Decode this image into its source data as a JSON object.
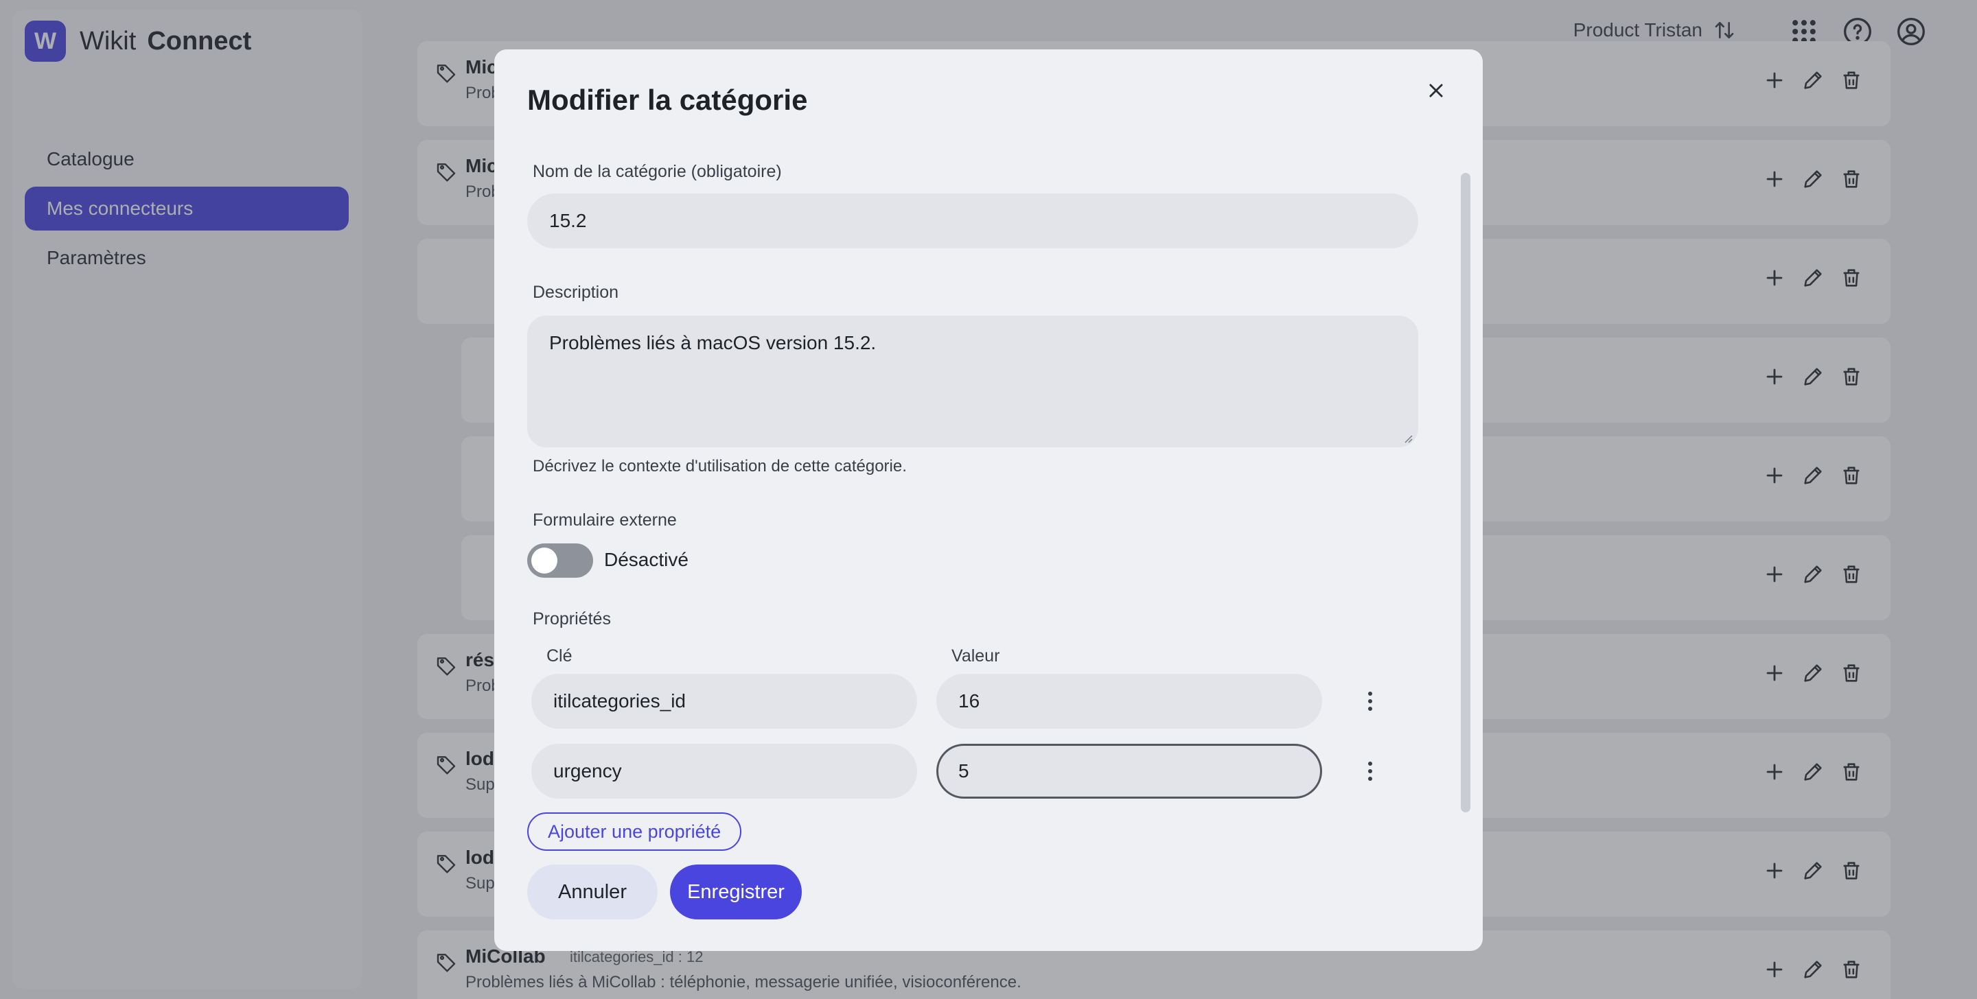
{
  "app": {
    "logo_letter": "W",
    "name_light": "Wikit",
    "name_bold": "Connect",
    "brand_color": "#4b45e0"
  },
  "sidebar": {
    "items": [
      {
        "label": "Catalogue",
        "active": false
      },
      {
        "label": "Mes connecteurs",
        "active": true
      },
      {
        "label": "Paramètres",
        "active": false
      }
    ]
  },
  "topbar": {
    "user": "Product Tristan",
    "icons": [
      "swap-vertical-icon",
      "apps-grid-icon",
      "help-icon",
      "account-icon"
    ]
  },
  "background_rows": [
    {
      "title": "Mic",
      "subtitle": "Prob"
    },
    {
      "title": "Mic",
      "subtitle": "Prob"
    },
    {
      "title": "",
      "subtitle": ""
    },
    {
      "title": "",
      "subtitle": ""
    },
    {
      "title": "",
      "subtitle": ""
    },
    {
      "title": "",
      "subtitle": ""
    },
    {
      "title": "rés",
      "subtitle": "Prob"
    },
    {
      "title": "lod",
      "subtitle": "Sup"
    },
    {
      "title": "lod",
      "subtitle": "Sup"
    },
    {
      "title": "MiCollab",
      "meta": "itilcategories_id : 12",
      "subtitle": "Problèmes liés à MiCollab : téléphonie, messagerie unifiée, visioconférence."
    }
  ],
  "modal": {
    "title": "Modifier la catégorie",
    "name_label": "Nom de la catégorie (obligatoire)",
    "name_value": "15.2",
    "description_label": "Description",
    "description_value": "Problèmes liés à macOS version 15.2.",
    "description_hint": "Décrivez le contexte d'utilisation de cette catégorie.",
    "external_form_label": "Formulaire externe",
    "external_form_state": "Désactivé",
    "properties_label": "Propriétés",
    "key_header": "Clé",
    "value_header": "Valeur",
    "properties": [
      {
        "key": "itilcategories_id",
        "value": "16"
      },
      {
        "key": "urgency",
        "value": "5"
      }
    ],
    "add_property_label": "Ajouter une propriété",
    "cancel_label": "Annuler",
    "save_label": "Enregistrer"
  }
}
